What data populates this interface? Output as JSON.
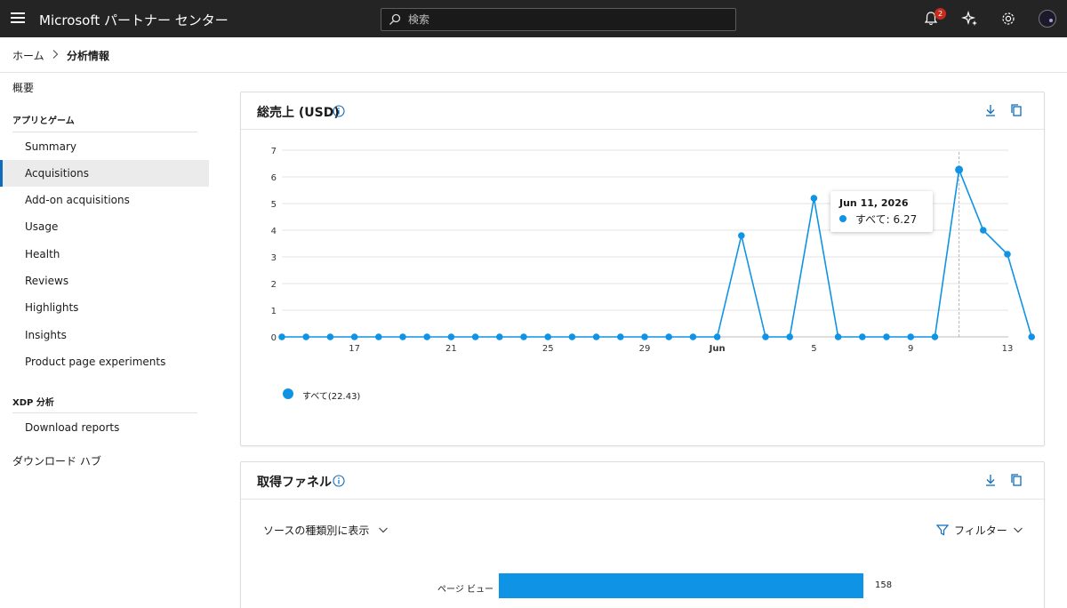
{
  "topbar": {
    "brand": "Microsoft パートナー センター",
    "search_placeholder": "検索",
    "notification_count": "2"
  },
  "breadcrumb": {
    "home": "ホーム",
    "current": "分析情報"
  },
  "sidebar": {
    "overview": "概要",
    "group_apps": "アプリとゲーム",
    "app_items": [
      {
        "label": "Summary"
      },
      {
        "label": "Acquisitions",
        "active": true
      },
      {
        "label": "Add-on acquisitions"
      },
      {
        "label": "Usage"
      },
      {
        "label": "Health"
      },
      {
        "label": "Reviews"
      },
      {
        "label": "Highlights"
      },
      {
        "label": "Insights"
      },
      {
        "label": "Product page experiments"
      }
    ],
    "group_xdp": "XDP 分析",
    "xdp_items": [
      {
        "label": "Download reports"
      }
    ],
    "download_hub": "ダウンロード ハブ"
  },
  "revenue_card": {
    "title": "総売上 (USD)",
    "tooltip": {
      "date": "Jun 11, 2026",
      "label": "すべて: 6.27"
    },
    "legend": "すべて(22.43)"
  },
  "funnel_card": {
    "title": "取得ファネル",
    "source_select": "ソースの種類別に表示",
    "filter_label": "フィルター",
    "rows": [
      {
        "label": "ページ ビュー",
        "value": "158"
      }
    ]
  },
  "colors": {
    "series": "#0f93e4",
    "accent": "#0f6cbd"
  },
  "chart_data": {
    "type": "line",
    "series": [
      {
        "name": "すべて",
        "values": [
          0,
          0,
          0,
          0,
          0,
          0,
          0,
          0,
          0,
          0,
          0,
          0,
          0,
          0,
          0,
          0,
          0,
          0,
          0,
          3.8,
          0,
          0,
          5.2,
          0,
          0,
          0,
          0,
          0,
          6.27,
          4.0,
          3.1,
          0
        ]
      }
    ],
    "x": [
      "May 14",
      "May 15",
      "May 16",
      "May 17",
      "May 18",
      "May 19",
      "May 20",
      "May 21",
      "May 22",
      "May 23",
      "May 24",
      "May 25",
      "May 26",
      "May 27",
      "May 28",
      "May 29",
      "May 30",
      "May 31",
      "Jun 1",
      "Jun 2",
      "Jun 3",
      "Jun 4",
      "Jun 5",
      "Jun 6",
      "Jun 7",
      "Jun 8",
      "Jun 9",
      "Jun 10",
      "Jun 11",
      "Jun 12",
      "Jun 13",
      "Jun 14"
    ],
    "x_tick_labels": [
      {
        "index": 3,
        "label": "17"
      },
      {
        "index": 7,
        "label": "21"
      },
      {
        "index": 11,
        "label": "25"
      },
      {
        "index": 15,
        "label": "29"
      },
      {
        "index": 18,
        "label": "Jun"
      },
      {
        "index": 22,
        "label": "5"
      },
      {
        "index": 26,
        "label": "9"
      },
      {
        "index": 30,
        "label": "13"
      }
    ],
    "y_ticks": [
      0,
      1,
      2,
      3,
      4,
      5,
      6,
      7
    ],
    "ylim": [
      0,
      7
    ],
    "highlight_index": 28,
    "grid": true,
    "legend_position": "bottom-left"
  }
}
